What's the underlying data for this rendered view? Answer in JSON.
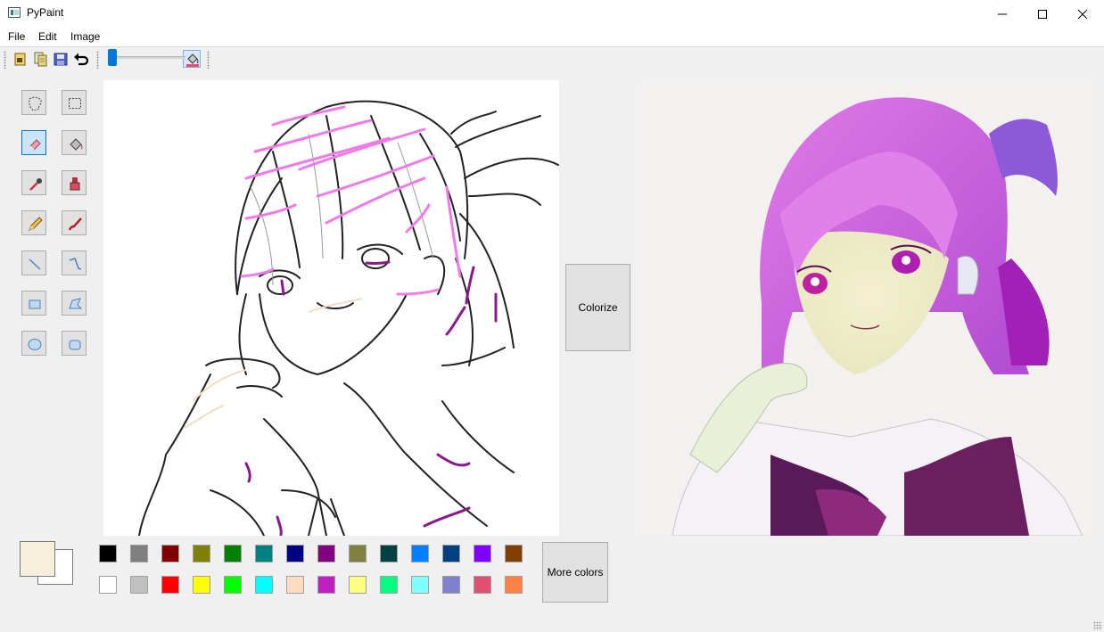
{
  "window": {
    "title": "PyPaint"
  },
  "menu": {
    "items": [
      "File",
      "Edit",
      "Image"
    ]
  },
  "toolbar": {
    "buttons": [
      "new-file-icon",
      "open-file-icon",
      "save-icon",
      "undo-icon",
      "fill-icon"
    ],
    "size_slider_level": 0.0
  },
  "tools": [
    {
      "name": "freeform-select",
      "active": false
    },
    {
      "name": "rect-select",
      "active": false
    },
    {
      "name": "eraser",
      "active": true
    },
    {
      "name": "fill",
      "active": false
    },
    {
      "name": "color-picker",
      "active": false
    },
    {
      "name": "stamp",
      "active": false
    },
    {
      "name": "pencil",
      "active": false
    },
    {
      "name": "brush",
      "active": false
    },
    {
      "name": "line",
      "active": false
    },
    {
      "name": "polyline",
      "active": false
    },
    {
      "name": "rectangle",
      "active": false
    },
    {
      "name": "polygon",
      "active": false
    },
    {
      "name": "ellipse",
      "active": false
    },
    {
      "name": "rounded-rect",
      "active": false
    }
  ],
  "actions": {
    "colorize_label": "Colorize",
    "more_colors_label": "More colors"
  },
  "colors": {
    "primary": "#f5efdc",
    "secondary": "#ffffff",
    "palette_row1": [
      "#000000",
      "#808080",
      "#800000",
      "#808000",
      "#008000",
      "#008080",
      "#000080",
      "#800080",
      "#808040",
      "#004040",
      "#0080ff",
      "#004080",
      "#8000ff",
      "#804000"
    ],
    "palette_row2": [
      "#ffffff",
      "#c0c0c0",
      "#ff0000",
      "#ffff00",
      "#00ff00",
      "#00ffff",
      "#ffdcc0",
      "#c020c0",
      "#ffff80",
      "#00ff80",
      "#80ffff",
      "#8080d0",
      "#e05070",
      "#ff8040"
    ]
  }
}
